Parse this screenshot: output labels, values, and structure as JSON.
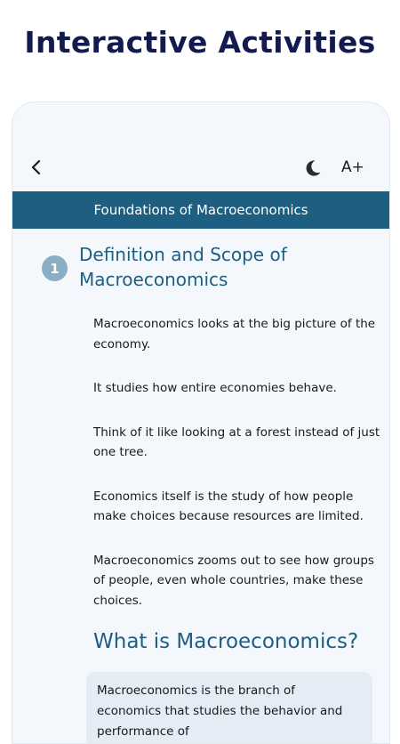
{
  "headline": "Interactive Activities",
  "toolbar": {
    "back_icon": "back-arrow-icon",
    "theme_icon": "moon-icon",
    "font_size_label": "A+"
  },
  "lesson": {
    "title": "Foundations of Macroeconomics",
    "section_number": "1",
    "section_title": "Definition and Scope of Macroeconomics",
    "paragraphs": [
      "Macroeconomics looks at the big picture of the economy.",
      "It studies how entire economies behave.",
      "Think of it like looking at a forest instead of just one tree.",
      "Economics itself is the study of how people make choices because resources are limited.",
      "Macroeconomics zooms out to see how groups of people, even whole countries, make these choices."
    ],
    "subheading": "What is Macroeconomics?",
    "definition": "Macroeconomics is the branch of economics that studies the behavior and performance of"
  },
  "colors": {
    "headline": "#131a4f",
    "accent": "#1e5e80",
    "badge": "#8aaec3",
    "background": "#f4f8fd",
    "definition_box": "#e4ecf5"
  }
}
